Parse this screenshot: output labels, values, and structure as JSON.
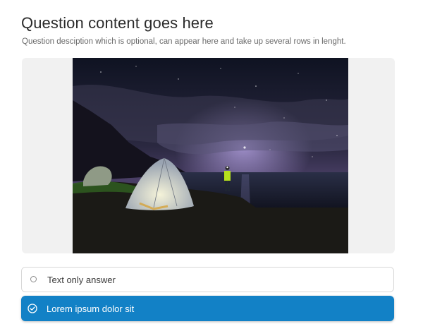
{
  "question": {
    "title": "Question content goes here",
    "description": "Question desciption which is optional, can appear here and take up several rows in lenght."
  },
  "media": {
    "image_subject": "camping-tent-night-sky-photo"
  },
  "answers": [
    {
      "label": "Text only answer",
      "selected": false,
      "icon": "radio-circle-icon"
    },
    {
      "label": "Lorem ipsum dolor sit",
      "selected": true,
      "icon": "check-circle-icon"
    }
  ],
  "colors": {
    "selected_bg": "#1281c6",
    "media_bg": "#f1f1f1",
    "border": "#d8d8d8"
  }
}
